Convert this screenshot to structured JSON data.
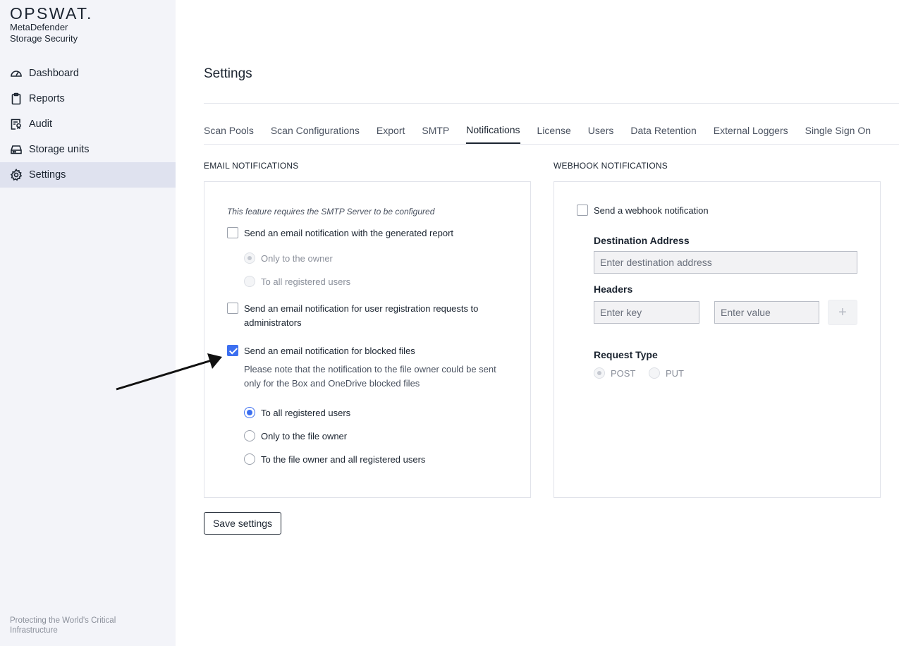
{
  "brand": {
    "logo": "OPSWAT.",
    "product_line1": "MetaDefender",
    "product_line2": "Storage Security",
    "tagline": "Protecting the World's Critical Infrastructure"
  },
  "sidebar": {
    "items": [
      {
        "label": "Dashboard",
        "icon": "gauge-icon",
        "active": false
      },
      {
        "label": "Reports",
        "icon": "clipboard-icon",
        "active": false
      },
      {
        "label": "Audit",
        "icon": "audit-icon",
        "active": false
      },
      {
        "label": "Storage units",
        "icon": "storage-icon",
        "active": false
      },
      {
        "label": "Settings",
        "icon": "gear-icon",
        "active": true
      }
    ]
  },
  "page": {
    "title": "Settings"
  },
  "tabs": [
    {
      "label": "Scan Pools",
      "active": false
    },
    {
      "label": "Scan Configurations",
      "active": false
    },
    {
      "label": "Export",
      "active": false
    },
    {
      "label": "SMTP",
      "active": false
    },
    {
      "label": "Notifications",
      "active": true
    },
    {
      "label": "License",
      "active": false
    },
    {
      "label": "Users",
      "active": false
    },
    {
      "label": "Data Retention",
      "active": false
    },
    {
      "label": "External Loggers",
      "active": false
    },
    {
      "label": "Single Sign On",
      "active": false
    }
  ],
  "email": {
    "section_label": "EMAIL NOTIFICATIONS",
    "note": "This feature requires the SMTP Server to be configured",
    "report": {
      "label": "Send an email notification with the generated report",
      "checked": false,
      "options": [
        {
          "label": "Only to the owner",
          "selected": true,
          "disabled": true
        },
        {
          "label": "To all registered users",
          "selected": false,
          "disabled": true
        }
      ]
    },
    "registration": {
      "label_line1": "Send an email notification for user registration requests to",
      "label_line2": "administrators",
      "checked": false
    },
    "blocked": {
      "label": "Send an email notification for blocked files",
      "checked": true,
      "hint": "Please note that the notification to the file owner could be sent only for the Box and OneDrive blocked files",
      "options": [
        {
          "label": "To all registered users",
          "selected": true
        },
        {
          "label": "Only to the file owner",
          "selected": false
        },
        {
          "label": "To the file owner and all registered users",
          "selected": false
        }
      ]
    }
  },
  "webhook": {
    "section_label": "WEBHOOK NOTIFICATIONS",
    "checkbox_label": "Send a webhook notification",
    "checked": false,
    "destination_label": "Destination Address",
    "destination_placeholder": "Enter destination address",
    "headers_label": "Headers",
    "key_placeholder": "Enter key",
    "value_placeholder": "Enter value",
    "add_symbol": "+",
    "request_type_label": "Request Type",
    "methods": [
      {
        "label": "POST",
        "selected": true,
        "disabled": true
      },
      {
        "label": "PUT",
        "selected": false,
        "disabled": true
      }
    ]
  },
  "actions": {
    "save_label": "Save settings"
  },
  "colors": {
    "accent": "#3c6ff0",
    "sidebar_bg": "#f3f4f9",
    "sidebar_active": "#dfe2ef"
  }
}
